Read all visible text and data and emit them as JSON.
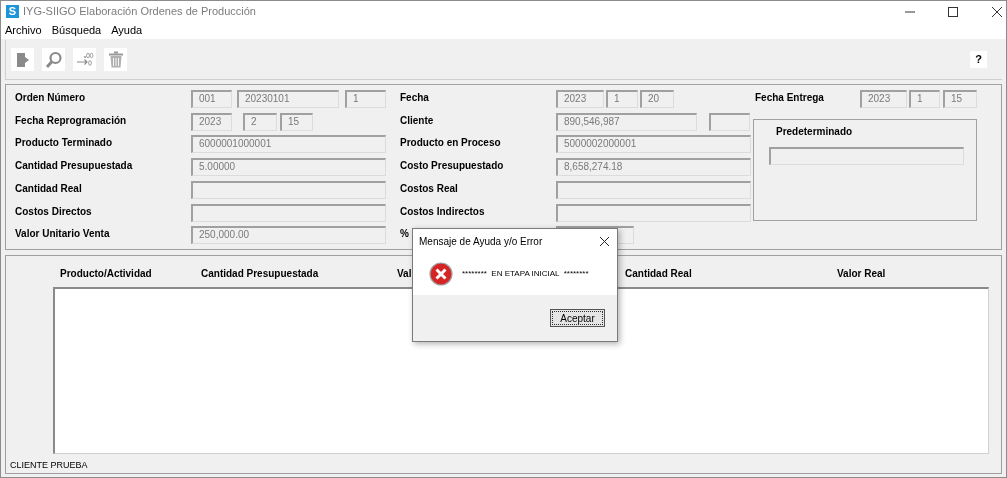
{
  "window": {
    "icon_letter": "S",
    "title": "IYG-SIIGO Elaboración Ordenes de Producción"
  },
  "menu": [
    "Archivo",
    "Búsqueda",
    "Ayuda"
  ],
  "toolbar": [
    {
      "kind": "exit"
    },
    {
      "kind": "search"
    },
    {
      "kind": "decimal"
    },
    {
      "kind": "delete"
    }
  ],
  "help_button": "?",
  "form": {
    "columns": [
      {
        "rows": [
          {
            "label": "Orden Número",
            "fields": [
              {
                "value": "001"
              },
              {
                "value": "20230101"
              },
              {
                "value": "1"
              }
            ]
          },
          {
            "label": "Fecha Reprogramación",
            "fields": [
              {
                "value": "2023"
              },
              {
                "value": "2"
              },
              {
                "value": "15"
              }
            ]
          },
          {
            "label": "Producto Terminado",
            "fields": [
              {
                "value": "6000001000001"
              }
            ]
          },
          {
            "label": "Cantidad Presupuestada",
            "fields": [
              {
                "value": "5.00000"
              }
            ]
          },
          {
            "label": "Cantidad Real"
          },
          {
            "label": "Costos Directos"
          },
          {
            "label": "Valor Unitario Venta",
            "fields": [
              {
                "value": "250,000.00"
              }
            ]
          }
        ]
      },
      {
        "rows": [
          {
            "label": "Fecha",
            "fields": [
              {
                "value": "2023"
              },
              {
                "value": "1"
              },
              {
                "value": "20"
              }
            ]
          },
          {
            "label": "Cliente",
            "fields": [
              {
                "value": "890,546,987"
              }
            ]
          },
          {
            "label": "Producto en Proceso",
            "fields": [
              {
                "value": "5000002000001"
              }
            ]
          },
          {
            "label": "Costo Presupuestado",
            "fields": [
              {
                "value": "8,658,274.18"
              }
            ]
          },
          {
            "label": "Costos Real"
          },
          {
            "label": "Costos Indirectos"
          },
          {
            "label": "%"
          }
        ]
      },
      {
        "rows": [
          {
            "label": "Fecha Entrega",
            "fields": [
              {
                "value": "2023"
              },
              {
                "value": "1"
              },
              {
                "value": "15"
              }
            ]
          }
        ]
      }
    ],
    "group": {
      "title": "Predeterminado"
    }
  },
  "grid": {
    "columns": [
      "Producto/Actividad",
      "Cantidad Presupuestada",
      "Val",
      "Cantidad Real",
      "Valor Real"
    ]
  },
  "status_bar": "CLIENTE PRUEBA",
  "dialog": {
    "title": "Mensaje de Ayuda y/o Error",
    "message": "********  EN ETAPA INICIAL  ********",
    "buttons": [
      "Aceptar"
    ]
  }
}
